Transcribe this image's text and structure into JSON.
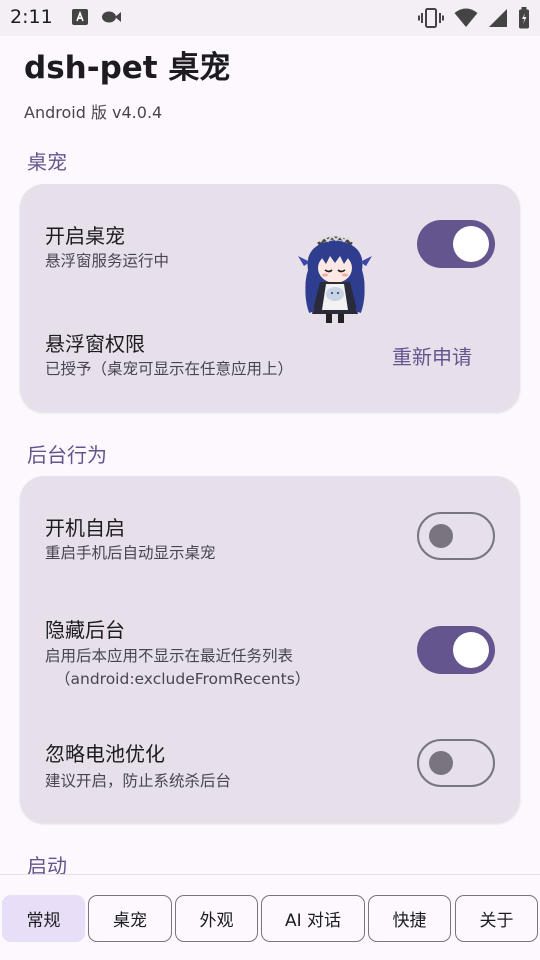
{
  "status_bar": {
    "time": "2:11"
  },
  "app": {
    "title": "dsh-pet 桌宠",
    "version": "Android 版 v4.0.4"
  },
  "sections": {
    "pet": {
      "title": "桌宠",
      "rows": {
        "enable": {
          "title": "开启桌宠",
          "subtitle": "悬浮窗服务运行中",
          "on": true
        },
        "permission": {
          "title": "悬浮窗权限",
          "subtitle": "已授予（桌宠可显示在任意应用上）",
          "action": "重新申请"
        }
      }
    },
    "background": {
      "title": "后台行为",
      "rows": {
        "autostart": {
          "title": "开机自启",
          "subtitle": "重启手机后自动显示桌宠",
          "on": false
        },
        "hide_recents": {
          "title": "隐藏后台",
          "subtitle": "启用后本应用不显示在最近任务列表",
          "subtitle2": "（android:excludeFromRecents）",
          "on": true
        },
        "battery": {
          "title": "忽略电池优化",
          "subtitle": "建议开启，防止系统杀后台",
          "on": false
        }
      }
    },
    "launch": {
      "title": "启动"
    }
  },
  "tabs": [
    {
      "label": "常规",
      "active": true
    },
    {
      "label": "桌宠",
      "active": false
    },
    {
      "label": "外观",
      "active": false
    },
    {
      "label": "AI 对话",
      "active": false
    },
    {
      "label": "快捷",
      "active": false
    },
    {
      "label": "关于",
      "active": false
    }
  ],
  "colors": {
    "primary": "#65558f",
    "card": "#e7e0eb",
    "background": "#fdf8fd",
    "active_tab": "#e8def8",
    "outline": "#79747e"
  }
}
